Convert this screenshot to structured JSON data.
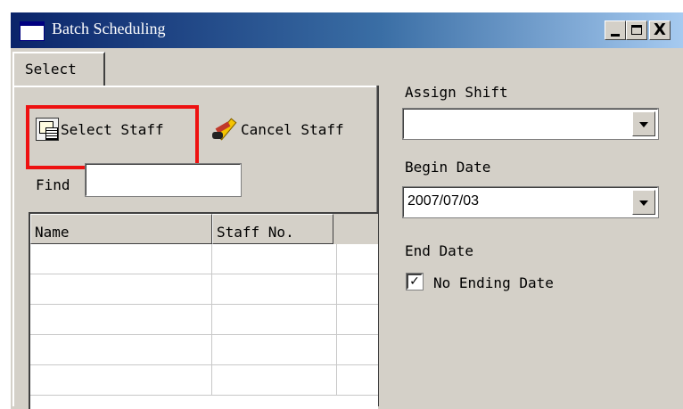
{
  "window": {
    "title": "Batch Scheduling",
    "controls": {
      "minimize": "_",
      "maximize": "□",
      "close": "X"
    }
  },
  "tabs": [
    {
      "label": "Select",
      "active": true
    }
  ],
  "toolbar": {
    "select_staff_label": "Select Staff",
    "select_staff_icon": "staff-list-icon",
    "cancel_staff_label": "Cancel Staff",
    "cancel_staff_icon": "eraser-icon"
  },
  "find": {
    "label": "Find",
    "value": ""
  },
  "grid": {
    "columns": [
      "Name",
      "Staff No."
    ],
    "rows": []
  },
  "right_panel": {
    "assign_shift_label": "Assign Shift",
    "assign_shift_value": "",
    "begin_date_label": "Begin Date",
    "begin_date_value": "2007/07/03",
    "end_date_label": "End Date",
    "no_ending_date_label": "No Ending Date",
    "no_ending_date_checked": true
  },
  "colors": {
    "title_bar_start": "#0a246a",
    "title_bar_end": "#a6caf0",
    "window_face": "#d4d0c8",
    "highlight": "#ee1111"
  }
}
